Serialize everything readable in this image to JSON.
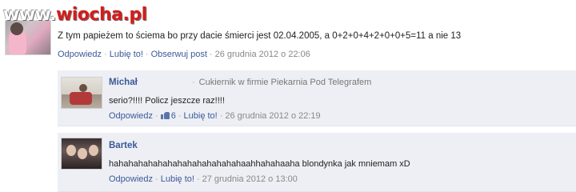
{
  "watermark": {
    "part1": "www.",
    "part2": "wiocha.pl"
  },
  "post": {
    "text": "Z tym papieżem to ściema bo przy dacie śmierci jest 02.04.2005, a 0+2+0+4+2+0+0+5=11 a nie 13",
    "actions": {
      "reply": "Odpowiedz",
      "like": "Lubię to!",
      "follow": "Obserwuj post"
    },
    "timestamp": "26 grudnia 2012 o 22:06"
  },
  "replies": [
    {
      "name": "Michał",
      "job": "Cukiernik w firmie Piekarnia Pod Telegrafem",
      "text": "serio?!!!! Policz jeszcze raz!!!!",
      "actions": {
        "reply": "Odpowiedz",
        "like_count": "6",
        "like": "Lubię to!"
      },
      "timestamp": "26 grudnia 2012 o 22:19"
    },
    {
      "name": "Bartek",
      "text": "hahahahahahahahahahahahahahaahhahahaaha blondynka jak mniemam xD",
      "actions": {
        "reply": "Odpowiedz",
        "like": "Lubię to!"
      },
      "timestamp": "27 grudnia 2012 o 13:00"
    }
  ],
  "icons": {
    "like": "thumbs-up-icon"
  },
  "colors": {
    "link": "#3b5998",
    "reply_bg": "#edeff4",
    "watermark_red": "#d41c1c"
  }
}
